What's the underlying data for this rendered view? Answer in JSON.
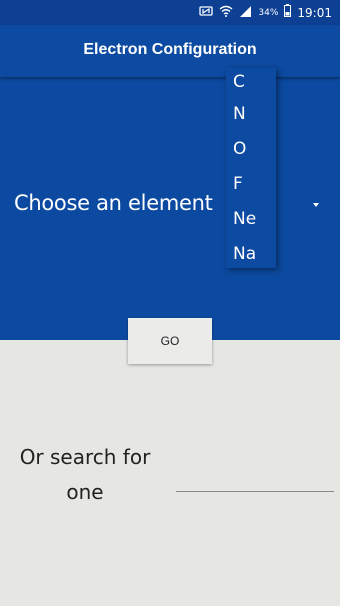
{
  "status_bar": {
    "time": "19:01",
    "battery_percent": "34%",
    "icons": [
      "nfc-icon",
      "wifi-icon",
      "signal-icon",
      "battery-icon"
    ]
  },
  "app_bar": {
    "title": "Electron Configuration"
  },
  "main": {
    "choose_label": "Choose an element",
    "dropdown_options": [
      "C",
      "N",
      "O",
      "F",
      "Ne",
      "Na"
    ],
    "go_label": "GO",
    "search_label": "Or search for one",
    "search_value": ""
  },
  "colors": {
    "primary": "#0c4aa1",
    "status_bar": "#0d3f93",
    "background": "#e6e6e3",
    "button": "#ebebea"
  }
}
